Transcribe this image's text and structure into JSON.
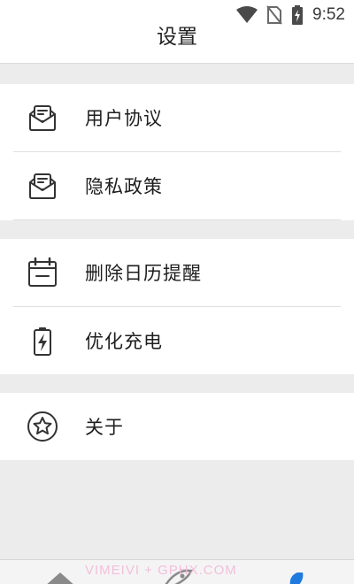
{
  "status": {
    "time": "9:52"
  },
  "header": {
    "title": "设置"
  },
  "groups": [
    {
      "items": [
        {
          "label": "用户协议",
          "icon": "mail-envelope-icon"
        },
        {
          "label": "隐私政策",
          "icon": "mail-envelope-icon"
        }
      ]
    },
    {
      "items": [
        {
          "label": "删除日历提醒",
          "icon": "calendar-icon"
        },
        {
          "label": "优化充电",
          "icon": "battery-charging-icon"
        }
      ]
    },
    {
      "items": [
        {
          "label": "关于",
          "icon": "star-circle-icon"
        }
      ]
    }
  ],
  "watermark": "VIMEIVI + GPHX.COM",
  "colors": {
    "background": "#ececec",
    "card": "#ffffff",
    "text": "#1e1e1e"
  }
}
